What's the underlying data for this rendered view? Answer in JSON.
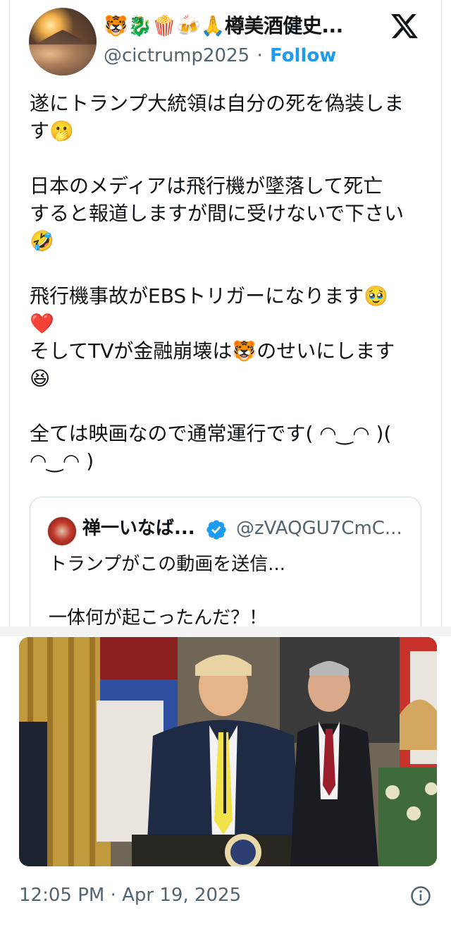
{
  "header": {
    "display_name": "🐯🐉🍿🍻🙏樽美酒健史...",
    "handle": "@cictrump2025",
    "separator": "·",
    "follow_label": "Follow",
    "platform_logo": "x-logo-icon"
  },
  "tweet": {
    "text": "遂にトランプ大統領は自分の死を偽装しま\nす🫢\n\n日本のメディアは飛行機が墜落して死亡\nすると報道しますが間に受けないで下さい\n🤣\n\n飛行機事故がEBSトリガーになります🥹\n❤️\nそしてTVが金融崩壊は🐯のせいにします\n😆\n\n全ては映画なので通常運行です( ◠‿◠ )(\n◠‿◠ )"
  },
  "quote": {
    "avatar_icon": "red-avatar-icon",
    "name": "禅一いなば...",
    "verified_icon": "verified-badge-icon",
    "handle": "@zVAQGU7CmC...",
    "text": "トランプがこの動画を送信...\n\n一体何が起こったんだ？！"
  },
  "video": {
    "thumbnail": "video-thumbnail"
  },
  "footer": {
    "time": "12:05 PM",
    "separator": "·",
    "date": "Apr 19, 2025",
    "info_icon": "info-icon"
  },
  "colors": {
    "accent": "#1d9bf0",
    "secondary_text": "#536471",
    "border": "#cfd9de"
  }
}
